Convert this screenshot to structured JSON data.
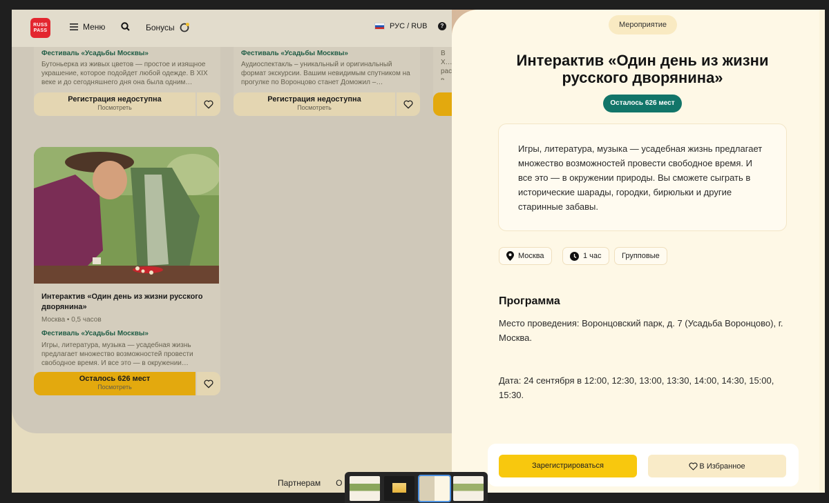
{
  "header": {
    "logo_text": "RUSS PASS",
    "menu_label": "Меню",
    "bonus_label": "Бонусы",
    "lang_label": "РУС / RUB",
    "help_glyph": "?"
  },
  "cards": {
    "card1": {
      "tag": "Фестиваль «Усадьбы Москвы»",
      "text": "Бутоньерка из живых цветов — простое и изящное украшение, которое подойдет любой одежде. В XIX веке и до сегодняшнего дня она была одним…",
      "action": "Регистрация недоступна",
      "sub": "Посмотреть"
    },
    "card2": {
      "tag": "Фестиваль «Усадьбы Москвы»",
      "text": "Аудиоспектакль – уникальный и оригинальный формат экскурсии. Вашим невидимым спутником на прогулке по Воронцово станет Доможил –…",
      "action": "Регистрация недоступна",
      "sub": "Посмотреть"
    },
    "card3": {
      "text": "В Х… рас… в ве…"
    },
    "card4": {
      "title": "Интерактив «Один день из жизни русского дворянина»",
      "meta": "Москва • 0,5 часов",
      "tag": "Фестиваль «Усадьбы Москвы»",
      "text": "Игры, литература, музыка — усадебная жизнь предлагает множество возможностей провести свободное время. И все это — в окружении…",
      "action": "Осталось 626 мест",
      "sub": "Посмотреть"
    }
  },
  "footer": {
    "link1": "Партнерам",
    "link2": "О"
  },
  "drawer": {
    "badge": "Мероприятие",
    "title": "Интерактив «Один день из жизни русского дворянина»",
    "seats": "Осталось 626 мест",
    "description": "Игры, литература, музыка — усадебная жизнь предлагает множество возможностей провести свободное время. И все это — в окружении природы. Вы сможете сыграть в исторические шарады, городки, бирюльки и другие старинные забавы.",
    "chips": {
      "city": "Москва",
      "duration": "1 час",
      "type": "Групповые"
    },
    "program_heading": "Программа",
    "program_place": "Место проведения: Воронцовский парк, д. 7 (Усадьба Воронцово), г. Москва.",
    "program_date": "Дата: 24 сентября в 12:00, 12:30, 13:00, 13:30, 14:00, 14:30, 15:00, 15:30.",
    "register_label": "Зарегистрироваться",
    "favorite_label": "В Избранное"
  },
  "colors": {
    "accent_yellow": "#f8c80e",
    "teal": "#127569",
    "brand_red": "#e3262f",
    "festival_green": "#1f5c45"
  },
  "icons": [
    "menu-icon",
    "search-icon",
    "bonus-icon",
    "flag-icon",
    "help-icon",
    "heart-icon",
    "location-pin-icon",
    "clock-icon"
  ]
}
